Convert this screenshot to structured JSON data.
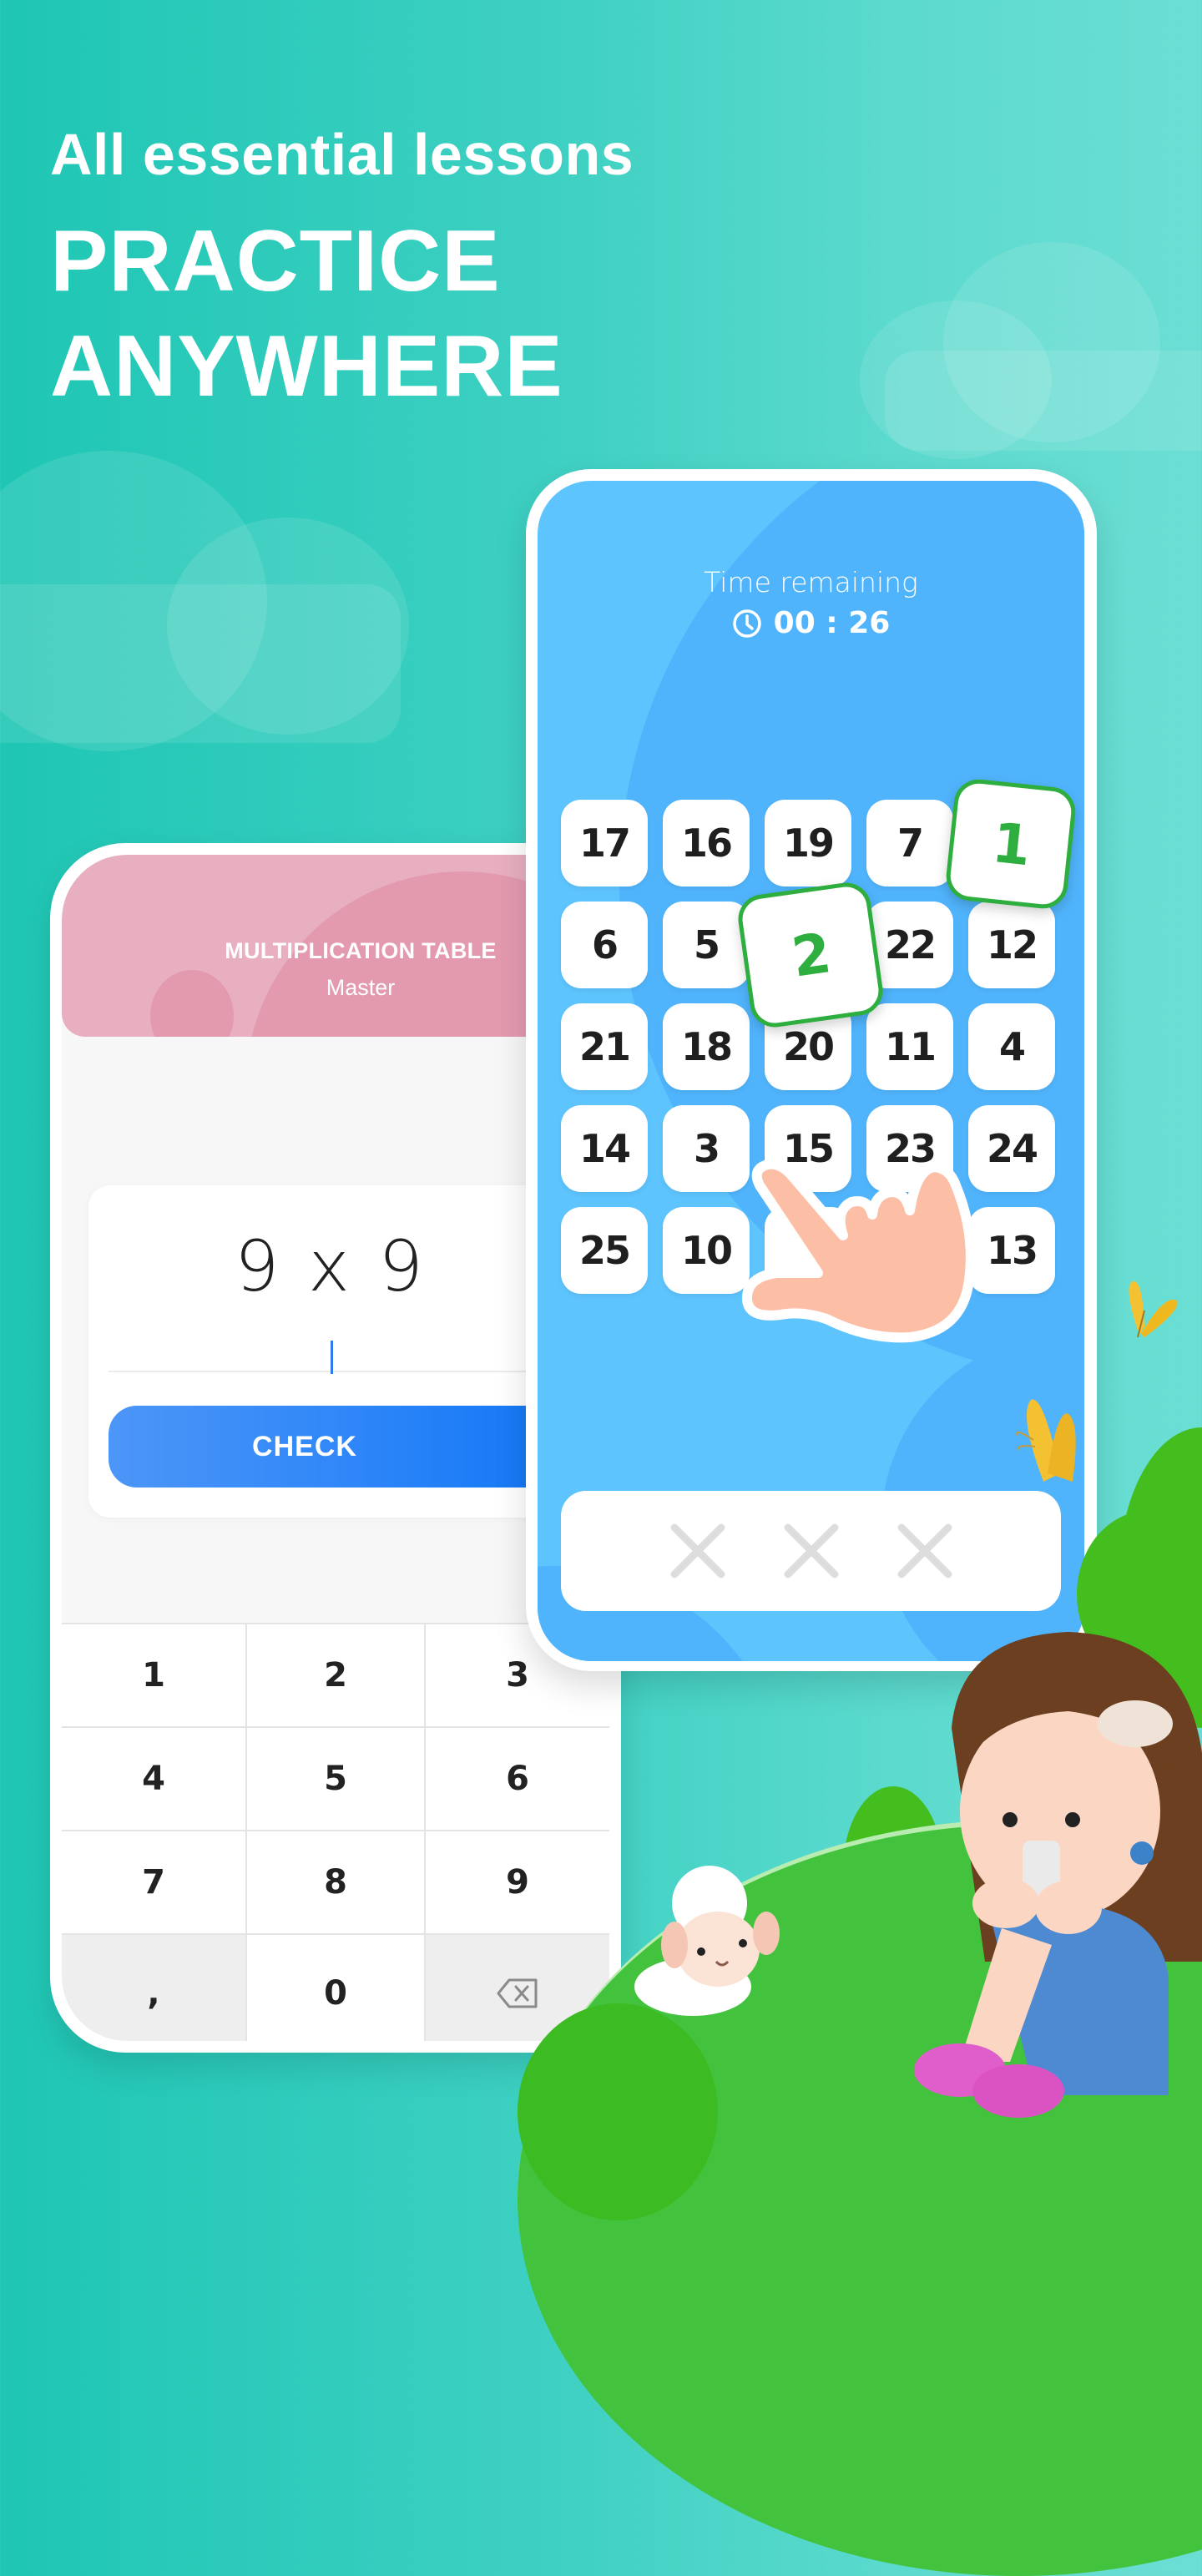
{
  "headline": {
    "subtitle": "All essential lessons",
    "title_line1": "PRACTICE",
    "title_line2": "ANYWHERE"
  },
  "colors": {
    "background_left": "#1FC6B4",
    "background_right": "#6BDED4",
    "header_pink": "#E8AFC0",
    "check_button_blue": "#2E86F8",
    "game_screen_blue": "#5EC4FE",
    "found_tile_green": "#2EAE3E"
  },
  "left_phone": {
    "header_title": "MULTIPLICATION TABLE",
    "header_subtitle": "Master",
    "question": "9 x 9",
    "answer_value": "",
    "check_label": "CHECK",
    "keypad": [
      [
        "1",
        "2",
        "3"
      ],
      [
        "4",
        "5",
        "6"
      ],
      [
        "7",
        "8",
        "9"
      ],
      [
        ",",
        "0",
        "backspace-icon"
      ]
    ]
  },
  "right_phone": {
    "time_label": "Time remaining",
    "timer_icon": "clock-icon",
    "timer_value": "00 : 26",
    "grid": [
      [
        "17",
        "16",
        "19",
        "7",
        ""
      ],
      [
        "6",
        "5",
        "",
        "22",
        "12"
      ],
      [
        "21",
        "18",
        "20",
        "11",
        "4"
      ],
      [
        "14",
        "3",
        "15",
        "23",
        "24"
      ],
      [
        "25",
        "10",
        "",
        "",
        "13"
      ]
    ],
    "found_tiles": [
      "1",
      "2"
    ],
    "mistakes": {
      "icon": "x-icon",
      "count_shown": 3,
      "used": 0
    }
  },
  "decorations": [
    "hand-pointer",
    "butterfly",
    "butterfly",
    "girl-with-phone",
    "sheep",
    "green-hill",
    "bushes",
    "clouds"
  ]
}
